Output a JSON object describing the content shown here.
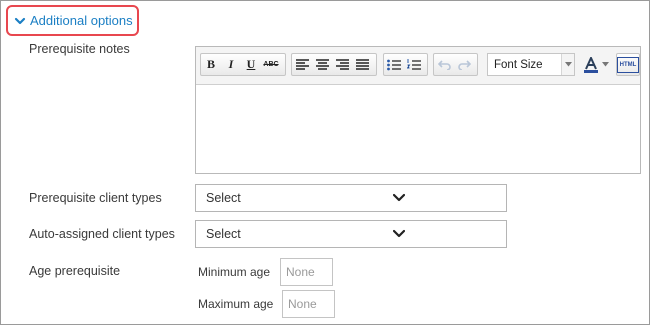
{
  "section": {
    "toggle_label": "Additional options",
    "expanded": true,
    "accent": "#1b7fc4",
    "highlight": "#e8474f"
  },
  "prereq_notes": {
    "label": "Prerequisite notes",
    "toolbar": {
      "buttons": [
        {
          "name": "bold-button",
          "glyph": "B"
        },
        {
          "name": "italic-button",
          "glyph": "I"
        },
        {
          "name": "underline-button",
          "glyph": "U"
        },
        {
          "name": "strikethrough-button",
          "glyph": "ABC"
        }
      ],
      "font_size_placeholder": "Font Size",
      "html_label": "HTML"
    },
    "content": ""
  },
  "prereq_client_types": {
    "label": "Prerequisite client types",
    "value": "Select"
  },
  "auto_client_types": {
    "label": "Auto-assigned client types",
    "value": "Select"
  },
  "age": {
    "label": "Age prerequisite",
    "min_label": "Minimum age",
    "min_placeholder": "None",
    "max_label": "Maximum age",
    "max_placeholder": "None"
  }
}
